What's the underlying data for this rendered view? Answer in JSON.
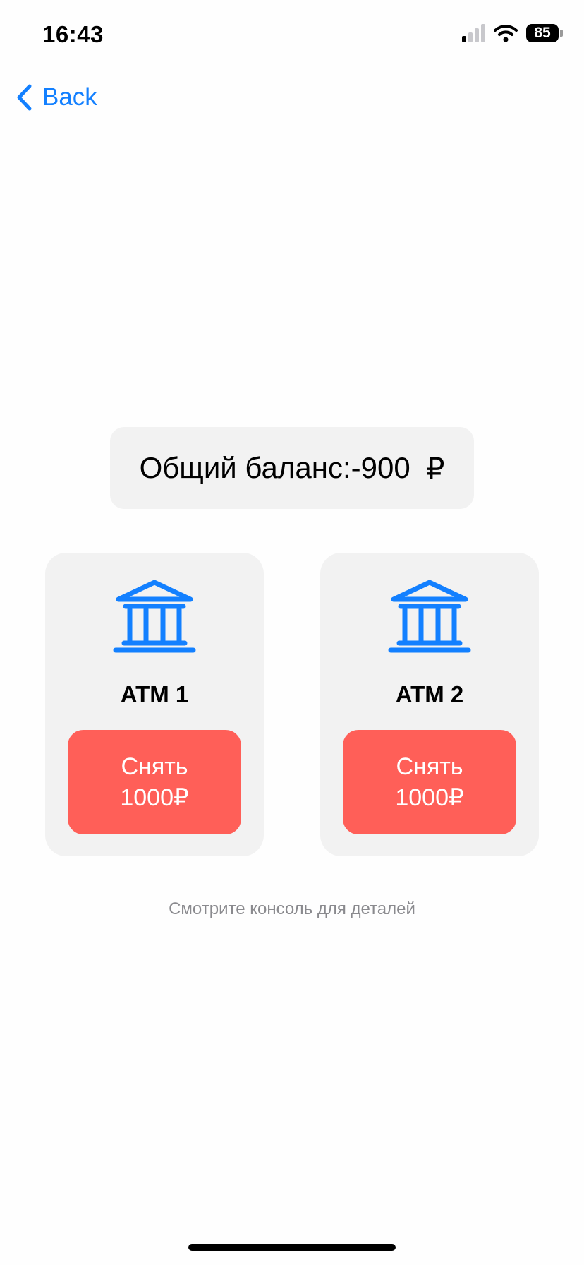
{
  "status_bar": {
    "time": "16:43",
    "battery": "85",
    "icons": [
      "cellular-signal-icon",
      "wifi-icon",
      "battery-icon"
    ]
  },
  "nav": {
    "back_label": "Back",
    "back_icon": "chevron-left-icon"
  },
  "balance": {
    "label": "Общий баланс:",
    "amount": "-900",
    "currency": "₽"
  },
  "atms": [
    {
      "icon": "bank-building-icon",
      "title": "ATM 1",
      "button_line1": "Снять",
      "button_line2": "1000₽"
    },
    {
      "icon": "bank-building-icon",
      "title": "ATM 2",
      "button_line1": "Снять",
      "button_line2": "1000₽"
    }
  ],
  "hint": "Смотрите консоль для деталей",
  "colors": {
    "accent": "#1380ff",
    "button": "#ff5f58",
    "card_bg": "#f2f2f2",
    "hint": "#8a8a8e"
  }
}
